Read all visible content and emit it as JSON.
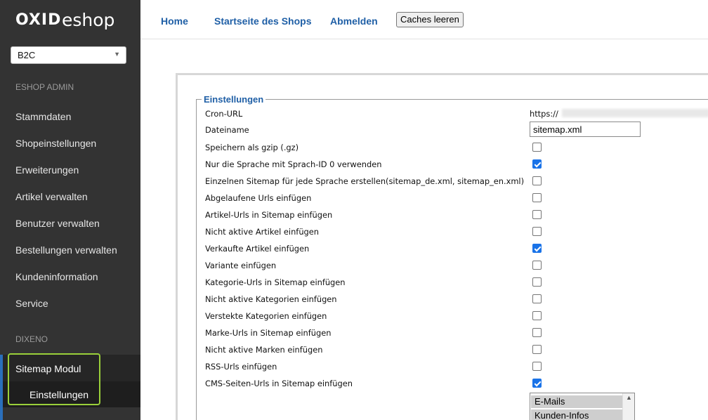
{
  "brand": {
    "part1": "OXID",
    "part2": "eshop"
  },
  "shop_select": {
    "value": "B2C"
  },
  "sidebar": {
    "section1": "ESHOP ADMIN",
    "items": [
      "Stammdaten",
      "Shopeinstellungen",
      "Erweiterungen",
      "Artikel verwalten",
      "Benutzer verwalten",
      "Bestellungen verwalten",
      "Kundeninformation",
      "Service"
    ],
    "section2": "DIXENO",
    "submenu": {
      "parent": "Sitemap Modul",
      "child": "Einstellungen"
    }
  },
  "topnav": {
    "home": "Home",
    "startseite": "Startseite des Shops",
    "abmelden": "Abmelden",
    "caches": "Caches leeren"
  },
  "settings": {
    "legend": "Einstellungen",
    "cron_url_label": "Cron-URL",
    "cron_url_value": "https://",
    "filename_label": "Dateiname",
    "filename_value": "sitemap.xml",
    "options": [
      {
        "label": "Speichern als gzip (.gz)",
        "checked": false
      },
      {
        "label": "Nur die Sprache mit Sprach-ID 0 verwenden",
        "checked": true
      },
      {
        "label": "Einzelnen Sitemap für jede Sprache erstellen(sitemap_de.xml, sitemap_en.xml)",
        "checked": false
      },
      {
        "label": "Abgelaufene Urls einfügen",
        "checked": false
      },
      {
        "label": "Artikel-Urls in Sitemap einfügen",
        "checked": false
      },
      {
        "label": "Nicht aktive Artikel einfügen",
        "checked": false
      },
      {
        "label": "Verkaufte Artikel einfügen",
        "checked": true
      },
      {
        "label": "Variante einfügen",
        "checked": false
      },
      {
        "label": "Kategorie-Urls in Sitemap einfügen",
        "checked": false
      },
      {
        "label": "Nicht aktive Kategorien einfügen",
        "checked": false
      },
      {
        "label": "Verstekte Kategorien einfügen",
        "checked": false
      },
      {
        "label": "Marke-Urls in Sitemap einfügen",
        "checked": false
      },
      {
        "label": "Nicht aktive Marken einfügen",
        "checked": false
      },
      {
        "label": "RSS-Urls einfügen",
        "checked": false
      },
      {
        "label": "CMS-Seiten-Urls in Sitemap einfügen",
        "checked": true
      }
    ],
    "cms_list": [
      "E-Mails",
      "Kunden-Infos"
    ]
  },
  "colors": {
    "sidebar_bg": "#333333",
    "link": "#1f5fa6",
    "highlight": "#9ad03a",
    "checkbox": "#1a73e8"
  }
}
